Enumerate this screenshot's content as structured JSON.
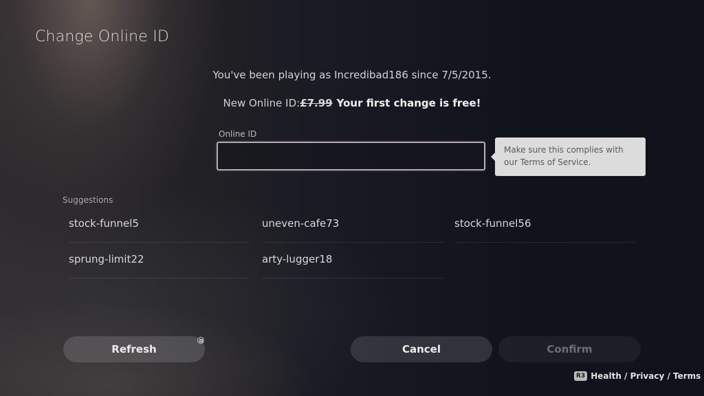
{
  "page": {
    "title": "Change Online ID"
  },
  "info": {
    "playing_as": "You've been playing as Incredibad186 since 7/5/2015.",
    "price_prefix": "New Online ID:",
    "old_price": "£7.99",
    "free_note": "Your first change is free!"
  },
  "online_id_field": {
    "label": "Online ID",
    "value": "",
    "placeholder": ""
  },
  "tooltip": {
    "text": "Make sure this complies with our Terms of Service."
  },
  "suggestions": {
    "label": "Suggestions",
    "items": [
      "stock-funnel5",
      "uneven-cafe73",
      "stock-funnel56",
      "sprung-limit22",
      "arty-lugger18"
    ]
  },
  "buttons": {
    "refresh": "Refresh",
    "refresh_hint_icon": "square-button-icon",
    "cancel": "Cancel",
    "confirm": "Confirm"
  },
  "footer": {
    "button_glyph": "R3",
    "links": "Health / Privacy / Terms"
  }
}
